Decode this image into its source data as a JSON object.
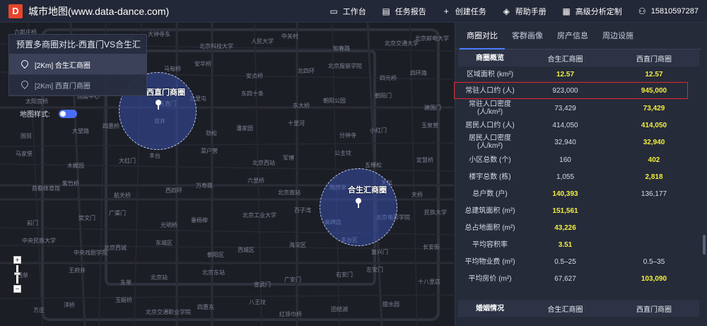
{
  "app": {
    "logo_letter": "D",
    "title": "城市地图(www.data-dance.com)"
  },
  "top_actions": [
    {
      "icon": "monitor-icon",
      "label": "工作台"
    },
    {
      "icon": "report-icon",
      "label": "任务报告"
    },
    {
      "icon": "plus-icon",
      "label": "创建任务"
    },
    {
      "icon": "layers-icon",
      "label": "帮助手册"
    },
    {
      "icon": "calendar-icon",
      "label": "高级分析定制"
    },
    {
      "icon": "user-icon",
      "label": "15810597287"
    }
  ],
  "compare_panel": {
    "title": "预置多商圈对比-西直门VS合生汇",
    "items": [
      {
        "label": "[2Km] 合生汇商圈",
        "active": true
      },
      {
        "label": "[2Km] 西直门商圈",
        "active": false
      }
    ],
    "style_label": "地图样式:"
  },
  "map": {
    "circles": [
      {
        "name": "西直门商圈"
      },
      {
        "name": "合生汇商圈"
      }
    ],
    "labels": [
      "六郎庄桥",
      "北京体育大学",
      "学院路",
      "大钟寺东",
      "北京科技大学",
      "人民大学",
      "中关村",
      "知春路",
      "北京交通大学",
      "北京邮电大学",
      "德外",
      "西直门",
      "积水潭桥",
      "马甸桥",
      "安华桥",
      "安贞桥",
      "北四环",
      "北京服装学院",
      "四元桥",
      "四环路",
      "太阳宫桥",
      "国展中心",
      "三元桥",
      "东直门",
      "三里屯",
      "东四十条",
      "东大桥",
      "朝阳公园",
      "朝阳门",
      "建国门",
      "国贸",
      "大望路",
      "四惠桥",
      "双井",
      "劲松",
      "潘家园",
      "十里河",
      "分钟寺",
      "小红门",
      "玉泉营",
      "马家堡",
      "木樨园",
      "大红门",
      "丰台",
      "菜户营",
      "北京西站",
      "军博",
      "公主坟",
      "五棵松",
      "定慧桥",
      "首都体育馆",
      "紫竹桥",
      "航天桥",
      "西四环",
      "万寿路",
      "六里桥",
      "北京南站",
      "陶然亭",
      "天坛",
      "天桥",
      "前门",
      "崇文门",
      "广渠门",
      "光明桥",
      "垂杨柳",
      "北京工业大学",
      "百子湾",
      "高碑店",
      "北京电影学院",
      "民族大学",
      "中央民族大学",
      "中央戏剧学院",
      "北京西城",
      "东城区",
      "朝阳区",
      "西城区",
      "海淀区",
      "丰台区",
      "复兴门",
      "长安街",
      "西单",
      "王府井",
      "东单",
      "北京站",
      "北京东站",
      "宣武门",
      "广安门",
      "右安门",
      "左安门",
      "十八里店",
      "方庄",
      "洋桥",
      "玉蜓桥",
      "北京交通职业学院",
      "四惠东",
      "八王坟",
      "红领巾桥",
      "团结湖",
      "甜水园"
    ],
    "zoom_plus": "+",
    "zoom_minus": "−"
  },
  "panel": {
    "tabs": [
      "商圈对比",
      "客群画像",
      "房产信息",
      "周边设施"
    ],
    "table1": {
      "header": [
        "商圈概览",
        "合生汇商圈",
        "西直门商圈"
      ],
      "rows": [
        {
          "label": "区域面积 (km²)",
          "a": "12.57",
          "b": "12.57",
          "hlA": true,
          "hlB": true
        },
        {
          "label": "常驻人口约 (人)",
          "a": "923,000",
          "b": "945,000",
          "hlA": false,
          "hlB": true
        },
        {
          "label": "常驻人口密度 (人/km²)",
          "a": "73,429",
          "b": "73,429",
          "hlA": false,
          "hlB": true
        },
        {
          "label": "居民人口约 (人)",
          "a": "414,050",
          "b": "414,050",
          "hlA": false,
          "hlB": true
        },
        {
          "label": "居民人口密度 (人/km²)",
          "a": "32,940",
          "b": "32,940",
          "hlA": false,
          "hlB": true
        },
        {
          "label": "小区总数 (个)",
          "a": "160",
          "b": "402",
          "hlA": false,
          "hlB": true
        },
        {
          "label": "楼宇总数 (栋)",
          "a": "1,055",
          "b": "2,818",
          "hlA": false,
          "hlB": true
        },
        {
          "label": "总户数 (户)",
          "a": "140,393",
          "b": "136,177",
          "hlA": true,
          "hlB": false
        },
        {
          "label": "总建筑面积 (m²)",
          "a": "151,561",
          "b": "",
          "hlA": true,
          "hlB": false
        },
        {
          "label": "总占地面积 (m²)",
          "a": "43,226",
          "b": "",
          "hlA": true,
          "hlB": false
        },
        {
          "label": "平均容积率",
          "a": "3.51",
          "b": "",
          "hlA": true,
          "hlB": false
        },
        {
          "label": "平均物业费 (m²)",
          "a": "0.5–25",
          "b": "0.5–35",
          "hlA": false,
          "hlB": false
        },
        {
          "label": "平均房价 (m²)",
          "a": "67,627",
          "b": "103,090",
          "hlA": false,
          "hlB": true
        }
      ]
    },
    "table2": {
      "header": [
        "婚姻情况",
        "合生汇商圈",
        "西直门商圈"
      ]
    }
  },
  "colors": {
    "highlight": "#f3ef3a",
    "accent": "#4a7cff",
    "red_box": "#e0282c"
  }
}
